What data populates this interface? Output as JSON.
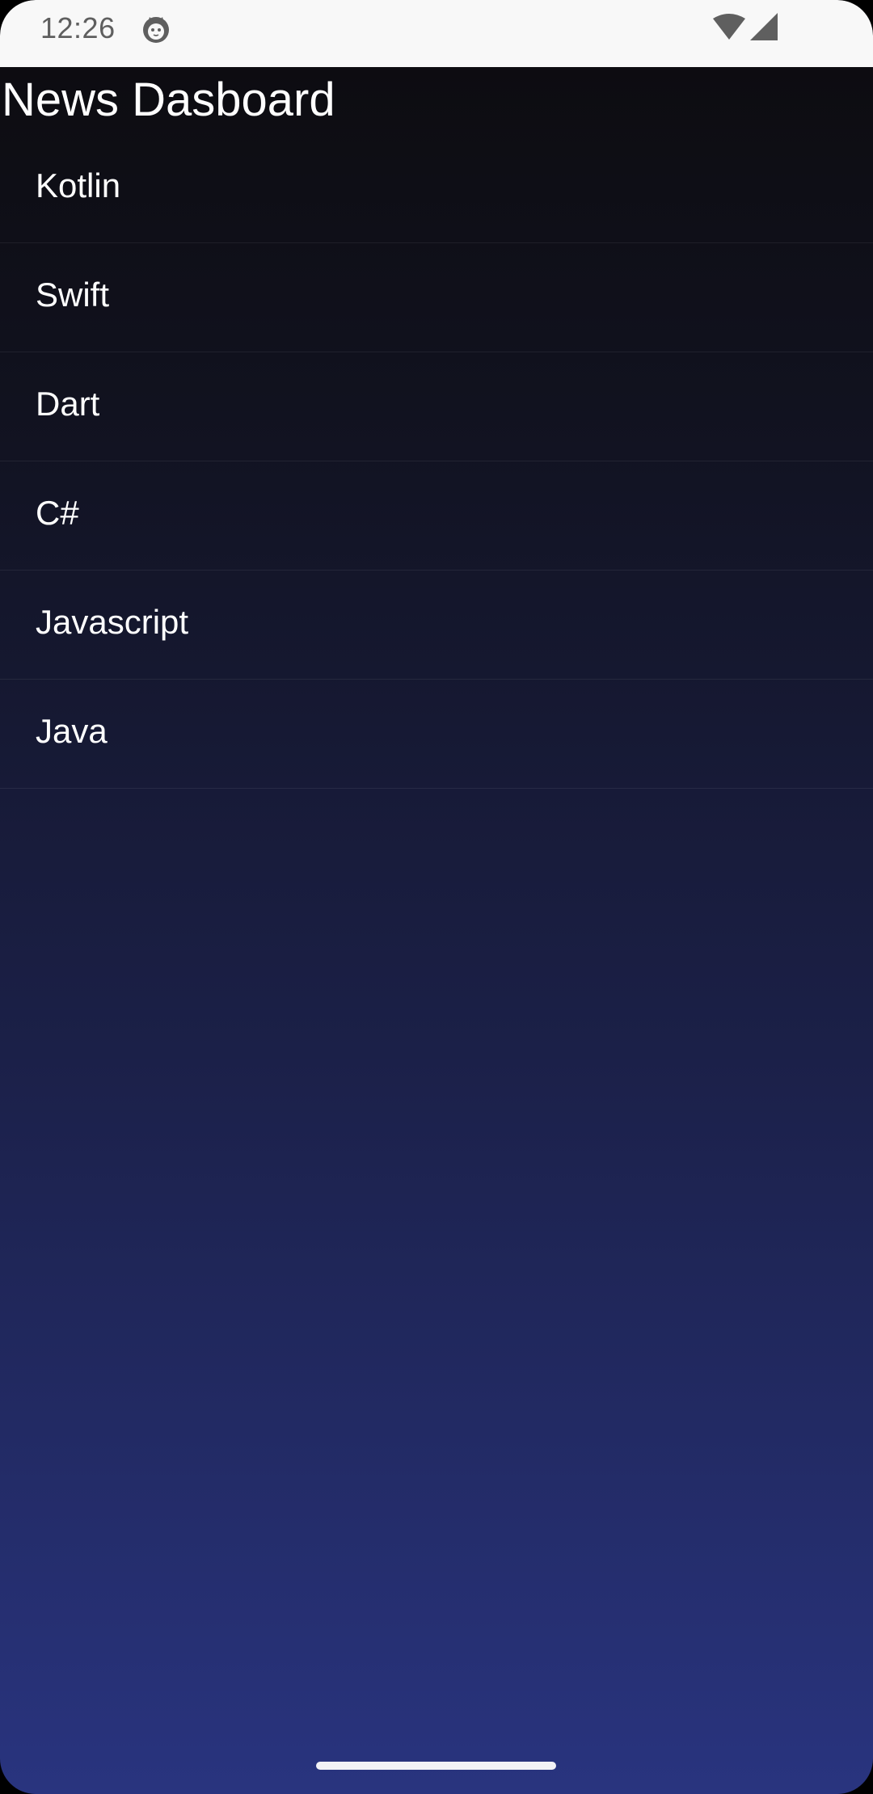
{
  "status_bar": {
    "time": "12:26",
    "app_icon": "cat-face-icon",
    "wifi_icon": "wifi-icon",
    "signal_icon": "cellular-signal-icon"
  },
  "header": {
    "title": "News Dasboard"
  },
  "topics": [
    {
      "label": "Kotlin"
    },
    {
      "label": "Swift"
    },
    {
      "label": "Dart"
    },
    {
      "label": "C#"
    },
    {
      "label": "Javascript"
    },
    {
      "label": "Java"
    }
  ],
  "colors": {
    "background_top": "#0c0b0e",
    "background_bottom": "#29347f",
    "status_bar": "#f8f8f8",
    "text": "#ffffff"
  }
}
